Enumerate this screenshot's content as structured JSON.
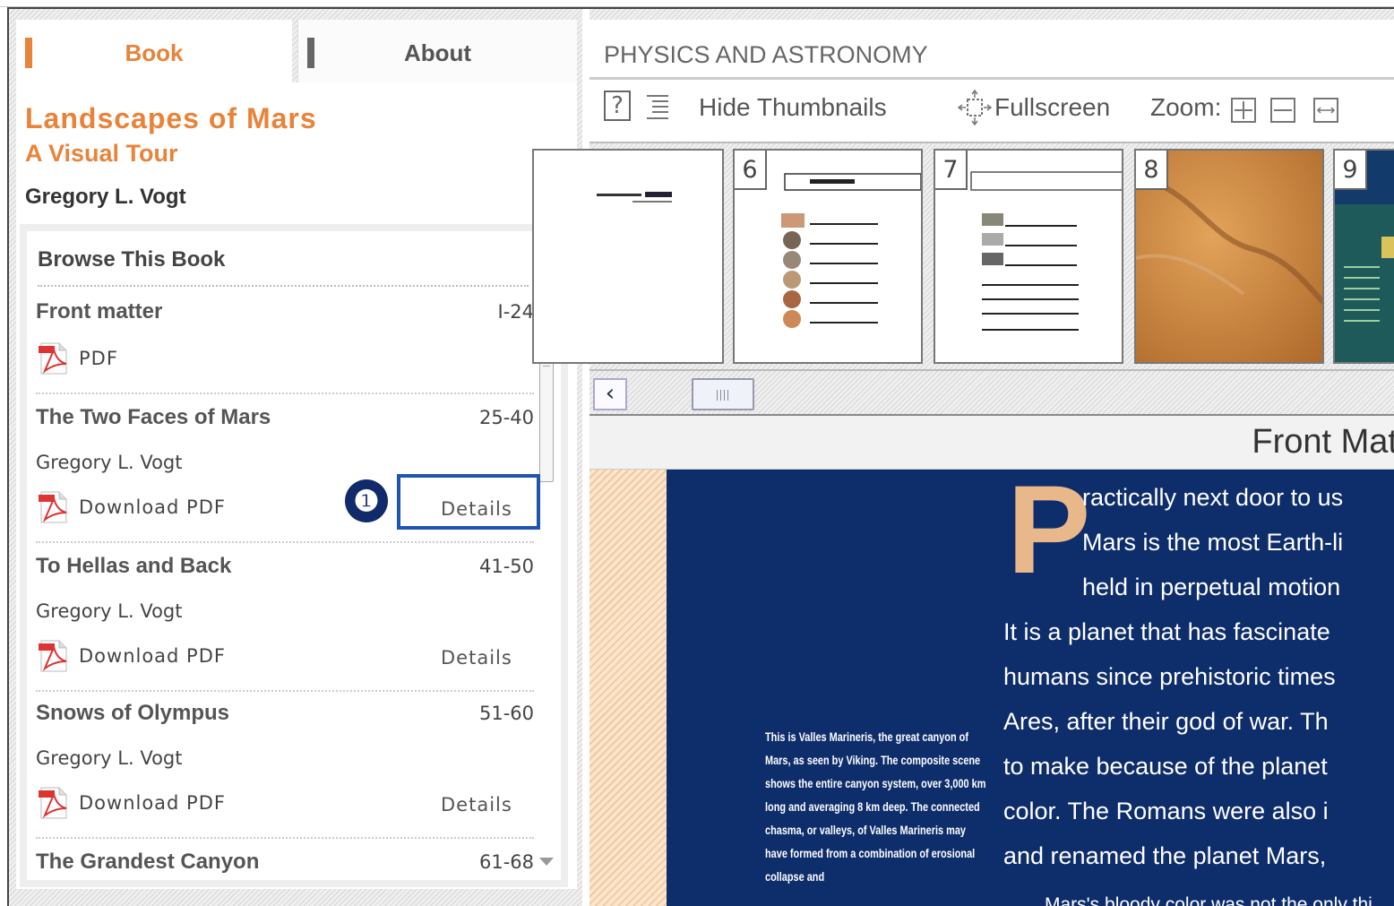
{
  "tabs": {
    "book": "Book",
    "about": "About"
  },
  "book": {
    "title": "Landscapes of Mars",
    "subtitle": "A Visual Tour",
    "author": "Gregory L. Vogt"
  },
  "browse": {
    "heading": "Browse This Book",
    "entries": [
      {
        "title": "Front matter",
        "pages": "I-24",
        "pdf_label": "PDF"
      },
      {
        "title": "The Two Faces of Mars",
        "pages": "25-40",
        "author": "Gregory L. Vogt",
        "pdf_label": "Download PDF",
        "details_label": "Details"
      },
      {
        "title": "To Hellas and Back",
        "pages": "41-50",
        "author": "Gregory L. Vogt",
        "pdf_label": "Download PDF",
        "details_label": "Details"
      },
      {
        "title": "Snows of Olympus",
        "pages": "51-60",
        "author": "Gregory L. Vogt",
        "pdf_label": "Download PDF",
        "details_label": "Details"
      },
      {
        "title": "The Grandest Canyon",
        "pages": "61-68"
      }
    ]
  },
  "callout": {
    "number": "❶"
  },
  "viewer": {
    "category": "PHYSICS AND ASTRONOMY",
    "toolbar": {
      "help": "?",
      "hide_thumbnails": "Hide Thumbnails",
      "fullscreen": "Fullscreen",
      "zoom": "Zoom:"
    },
    "thumbnails": [
      {
        "number": ""
      },
      {
        "number": "6"
      },
      {
        "number": "7"
      },
      {
        "number": "8"
      },
      {
        "number": "9"
      }
    ],
    "section_title": "Front Mat",
    "page": {
      "dropcap": "P",
      "lines": [
        "ractically next door to us",
        "Mars is the most Earth-li",
        "held in perpetual motion",
        "It is a planet that has fascinate",
        "humans since prehistoric times",
        "Ares, after their god of war. Th",
        "to make because of the planet",
        "color. The Romans were also i",
        "and renamed the planet Mars,",
        "Mars's bloody color was not the only thi"
      ],
      "caption": "This is Valles Marineris, the great canyon of Mars, as seen by Viking. The composite scene shows the entire canyon system, over 3,000 km long and averaging 8 km deep. The connected chasma, or valleys, of Valles Marineris may have formed from a combination of erosional collapse and"
    }
  },
  "colors": {
    "accent": "#e8833a",
    "callout_blue": "#1f55b0",
    "page_blue": "#0e2d6b",
    "dropcap": "#e8b88a"
  }
}
